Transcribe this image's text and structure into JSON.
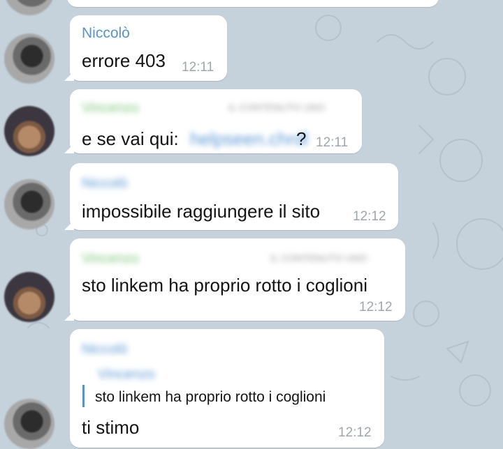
{
  "chat": {
    "messages": [
      {
        "sender": "Niccolò",
        "text": "errore 403",
        "time": "12:11"
      },
      {
        "reply_name": "Vincenzo",
        "reply_meta": "IL CONTENUTO UNO",
        "text_before": "e se vai qui:",
        "link": "helpseen.chrdl",
        "text_after": "?",
        "time": "12:11"
      },
      {
        "reply_name": "Niccolò",
        "text": "impossibile raggiungere il sito",
        "time": "12:12"
      },
      {
        "reply_name": "Vincenzo",
        "reply_meta": "IL CONTENUTO UNO",
        "text": "sto linkem ha proprio rotto i coglioni",
        "time": "12:12"
      },
      {
        "header_name": "Niccolò",
        "quote_name": "Vincenzo",
        "quote_text": "sto linkem ha proprio rotto i coglioni",
        "text": "ti stimo",
        "time": "12:12"
      }
    ]
  }
}
